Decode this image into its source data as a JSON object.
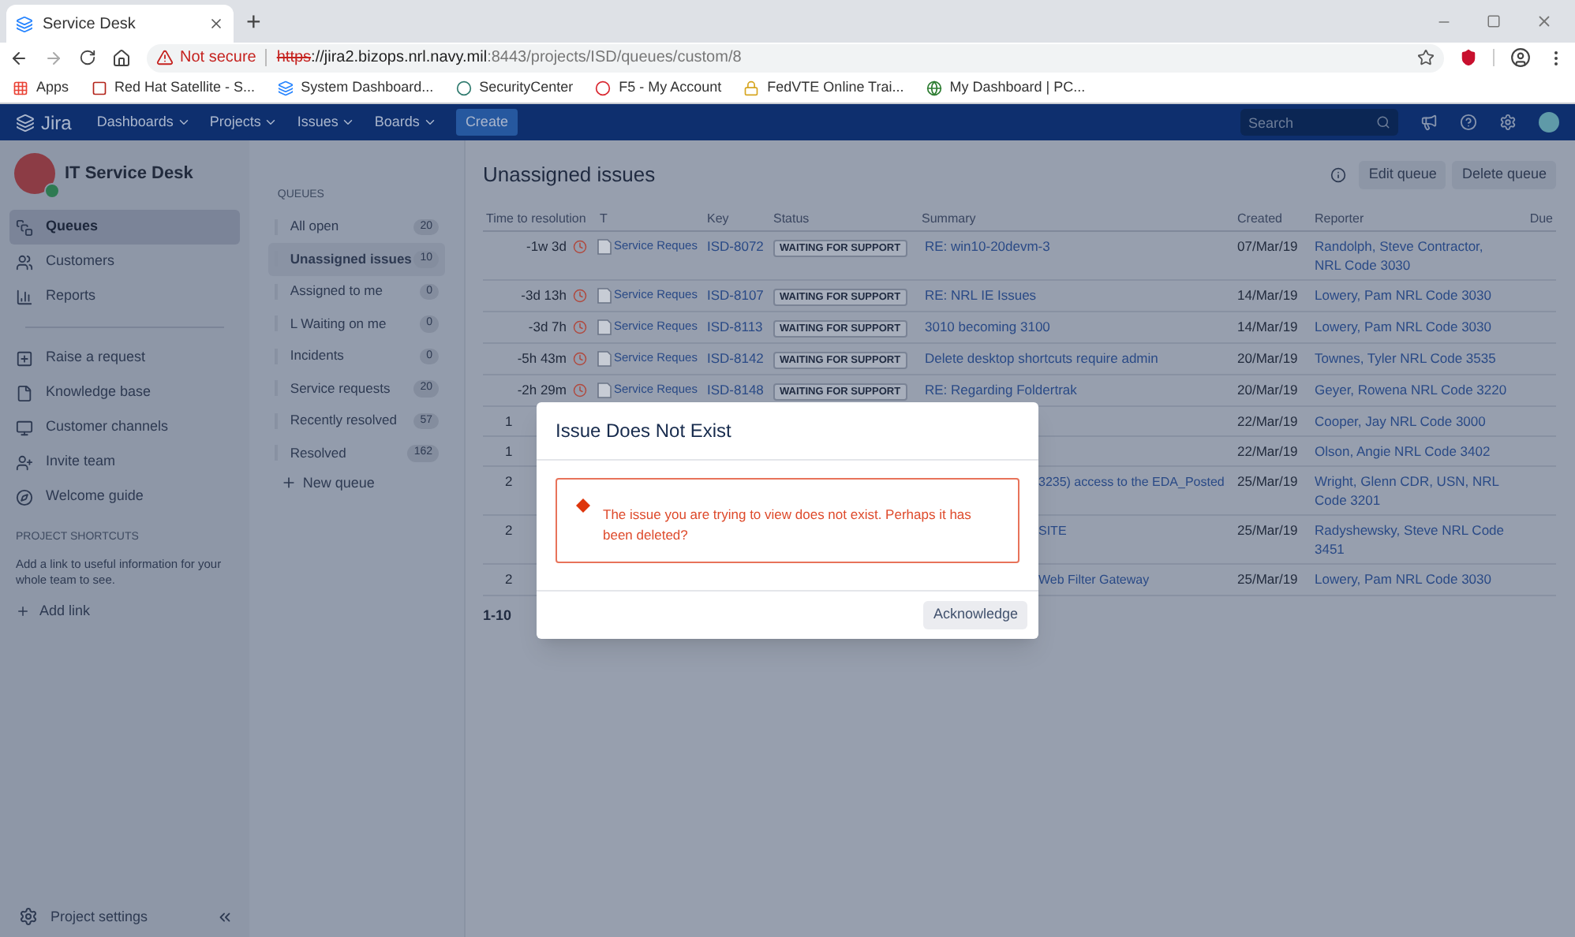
{
  "browser": {
    "tab_title": "Service Desk",
    "new_tab": "+",
    "not_secure": "Not secure",
    "url_scheme": "https",
    "url_host": "://jira2.bizops.nrl.navy.mil",
    "url_path": ":8443/projects/ISD/queues/custom/8",
    "bookmarks": [
      {
        "label": "Apps",
        "kind": "apps"
      },
      {
        "label": "Red Hat Satellite - S...",
        "kind": "redhat"
      },
      {
        "label": "System Dashboard...",
        "kind": "jira"
      },
      {
        "label": "SecurityCenter",
        "kind": "security"
      },
      {
        "label": "F5 - My Account",
        "kind": "f5"
      },
      {
        "label": "FedVTE Online Trai...",
        "kind": "lock"
      },
      {
        "label": "My Dashboard | PC...",
        "kind": "globe"
      }
    ]
  },
  "nav": {
    "logo": "Jira",
    "menus": [
      "Dashboards",
      "Projects",
      "Issues",
      "Boards"
    ],
    "create": "Create",
    "search": {
      "placeholder": "Search"
    }
  },
  "sidebar": {
    "project": "IT Service Desk",
    "items": [
      {
        "label": "Queues",
        "kind": "queues",
        "selected": true
      },
      {
        "label": "Customers",
        "kind": "customers",
        "selected": false
      },
      {
        "label": "Reports",
        "kind": "reports",
        "selected": false
      }
    ],
    "items_2": [
      {
        "label": "Raise a request",
        "kind": "raise"
      },
      {
        "label": "Knowledge base",
        "kind": "knowledge"
      },
      {
        "label": "Customer channels",
        "kind": "channels"
      },
      {
        "label": "Invite team",
        "kind": "invite"
      },
      {
        "label": "Welcome guide",
        "kind": "guide"
      }
    ],
    "shortcuts": {
      "heading": "PROJECT SHORTCUTS",
      "text": "Add a link to useful information for your whole team to see.",
      "add": "Add link"
    },
    "settings": "Project settings"
  },
  "queues": {
    "heading": "QUEUES",
    "items": [
      {
        "label": "All open",
        "count": "20",
        "selected": false
      },
      {
        "label": "Unassigned issues",
        "count": "10",
        "selected": true
      },
      {
        "label": "Assigned to me",
        "count": "0",
        "selected": false
      },
      {
        "label": "L Waiting on me",
        "count": "0",
        "selected": false
      },
      {
        "label": "Incidents",
        "count": "0",
        "selected": false
      },
      {
        "label": "Service requests",
        "count": "20",
        "selected": false
      },
      {
        "label": "Recently resolved",
        "count": "57",
        "selected": false
      },
      {
        "label": "Resolved",
        "count": "162",
        "selected": false
      }
    ],
    "new": "New queue"
  },
  "content": {
    "title": "Unassigned issues",
    "edit": "Edit queue",
    "delete": "Delete queue",
    "columns": [
      "Time to resolution",
      "T",
      "Key",
      "Status",
      "Summary",
      "Created",
      "Reporter",
      "Due"
    ],
    "rows": [
      {
        "kind": "full",
        "time": "-1w 3d",
        "type": "Service Reques",
        "key": "ISD-8072",
        "status": "WAITING FOR SUPPORT",
        "summary": "RE: win10-20devm-3",
        "created": "07/Mar/19",
        "reporter": "Randolph, Steve Contractor, NRL Code 3030"
      },
      {
        "kind": "full",
        "time": "-3d 13h",
        "type": "Service Reques",
        "key": "ISD-8107",
        "status": "WAITING FOR SUPPORT",
        "summary": "RE: NRL IE Issues",
        "created": "14/Mar/19",
        "reporter": "Lowery, Pam NRL Code 3030"
      },
      {
        "kind": "full",
        "time": "-3d 7h",
        "type": "Service Reques",
        "key": "ISD-8113",
        "status": "WAITING FOR SUPPORT",
        "summary": "3010 becoming 3100",
        "created": "14/Mar/19",
        "reporter": "Lowery, Pam NRL Code 3030"
      },
      {
        "kind": "full",
        "time": "-5h 43m",
        "type": "Service Reques",
        "key": "ISD-8142",
        "status": "WAITING FOR SUPPORT",
        "summary": "Delete desktop shortcuts require admin",
        "created": "20/Mar/19",
        "reporter": "Townes, Tyler NRL Code 3535"
      },
      {
        "kind": "full",
        "time": "-2h 29m",
        "type": "Service Reques",
        "key": "ISD-8148",
        "status": "WAITING FOR SUPPORT",
        "summary": "RE: Regarding Foldertrak",
        "created": "20/Mar/19",
        "reporter": "Geyer, Rowena NRL Code 3220"
      },
      {
        "kind": "covered",
        "time": "1",
        "created": "22/Mar/19",
        "reporter": "Cooper, Jay NRL Code 3000"
      },
      {
        "kind": "covered",
        "time": "1",
        "created": "22/Mar/19",
        "reporter": "Olson, Angie NRL Code 3402"
      },
      {
        "kind": "covered",
        "time": "2",
        "summary": "3235) access to the EDA_Posted",
        "created": "25/Mar/19",
        "reporter": "Wright, Glenn CDR, USN, NRL Code 3201"
      },
      {
        "kind": "covered",
        "time": "2",
        "summary": "SITE",
        "created": "25/Mar/19",
        "reporter": "Radyshewsky, Steve NRL Code 3451"
      },
      {
        "kind": "covered",
        "time": "2",
        "summary": "Web Filter Gateway",
        "created": "25/Mar/19",
        "reporter": "Lowery, Pam NRL Code 3030"
      }
    ],
    "pagination": "1-10"
  },
  "dialog": {
    "title": "Issue Does Not Exist",
    "message": "The issue you are trying to view does not exist. Perhaps it has been deleted?",
    "button": "Acknowledge"
  }
}
